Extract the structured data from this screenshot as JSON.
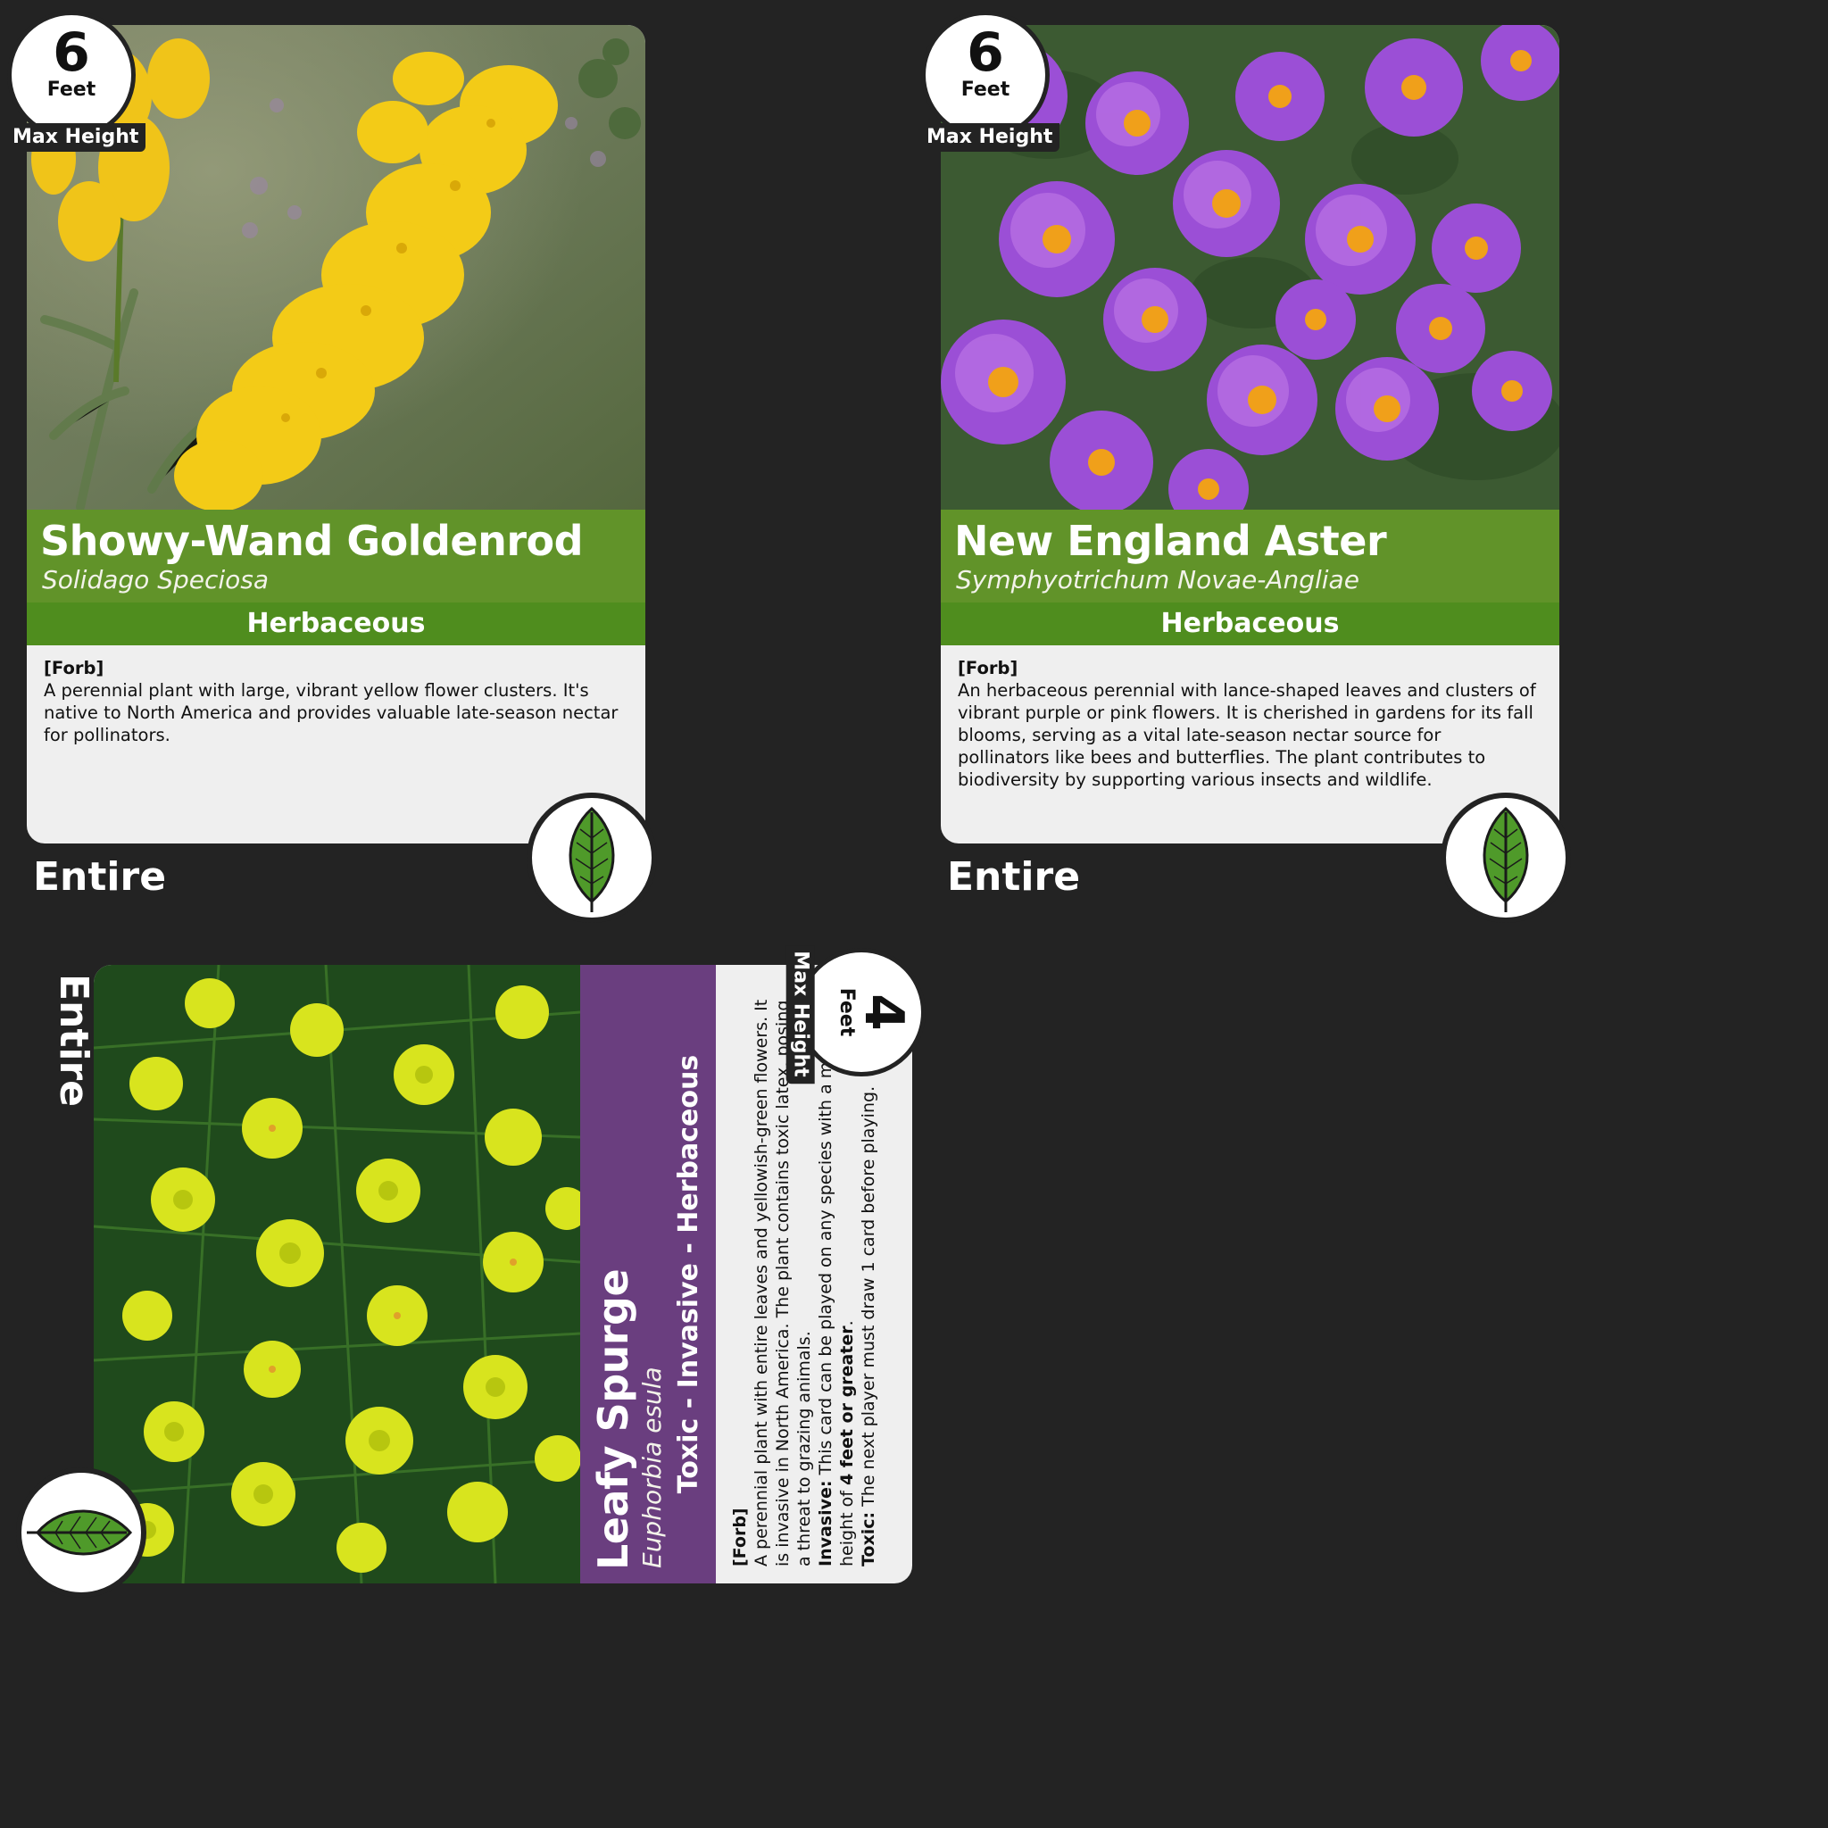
{
  "cards": [
    {
      "name": "Showy-Wand Goldenrod",
      "scientific": "Solidago Speciosa",
      "type": "Herbaceous",
      "tag": "[Forb]",
      "description": "A perennial plant with large, vibrant yellow flower clusters. It's native to North America and provides valuable late-season nectar for pollinators.",
      "height_value": "6",
      "height_unit": "Feet",
      "height_label": "Max Height",
      "leaf_margin": "Entire",
      "leaf_icon": "entire-leaf-icon",
      "band_color": "#568c1a"
    },
    {
      "name": "New England Aster",
      "scientific": "Symphyotrichum Novae-Angliae",
      "type": "Herbaceous",
      "tag": "[Forb]",
      "description": "An herbaceous perennial with lance-shaped leaves and clusters of vibrant purple or pink flowers. It is cherished in gardens for its fall blooms, serving as a vital late-season nectar source for pollinators like bees and butterflies. The plant contributes to biodiversity by supporting various insects and wildlife.",
      "height_value": "6",
      "height_unit": "Feet",
      "height_label": "Max Height",
      "leaf_margin": "Entire",
      "leaf_icon": "entire-leaf-icon",
      "band_color": "#568c1a"
    },
    {
      "name": "Leafy Spurge",
      "scientific": "Euphorbia esula",
      "type": "Toxic - Invasive - Herbaceous",
      "tag": "[Forb]",
      "description": "A perennial plant with entire leaves and yellowish-green flowers. It is invasive in North America. The plant contains toxic latex, posing a threat to grazing animals.",
      "invasive_label": "Invasive:",
      "invasive_text_1": "This card can be played on any species with a max height of",
      "invasive_bold": "4 feet or greater",
      "invasive_text_2": ".",
      "toxic_label": "Toxic:",
      "toxic_text": "The next player must draw 1 card before playing.",
      "height_value": "4",
      "height_unit": "Feet",
      "height_label": "Max Height",
      "leaf_margin": "Entire",
      "leaf_icon": "entire-leaf-icon",
      "band_color": "#623478"
    }
  ]
}
